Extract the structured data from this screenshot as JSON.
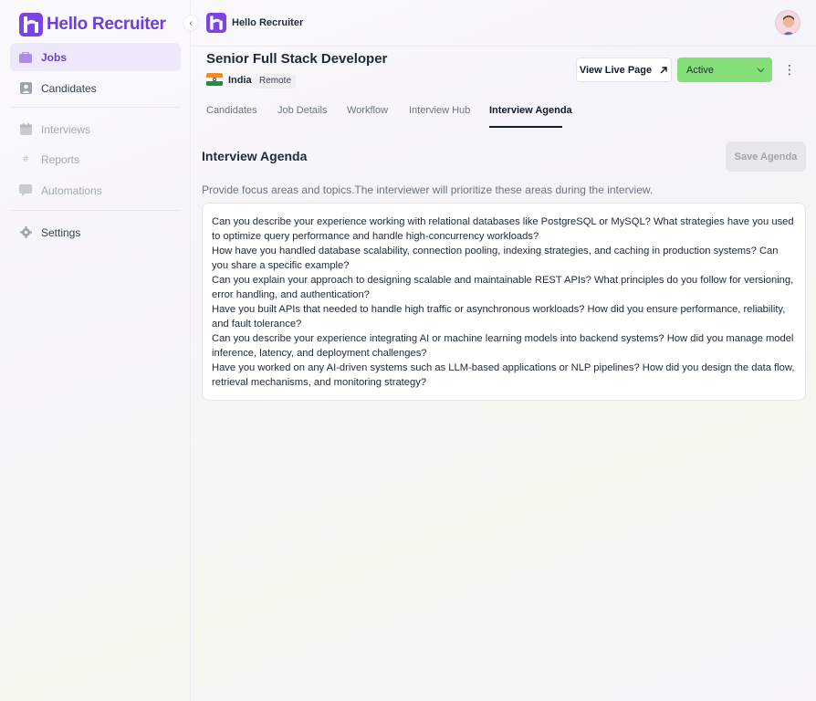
{
  "brand": {
    "name": "Hello Recruiter",
    "color": "#6d3fd8"
  },
  "sidebar": {
    "items": [
      {
        "label": "Jobs",
        "icon": "briefcase-icon",
        "state": "active"
      },
      {
        "label": "Candidates",
        "icon": "person-icon",
        "state": "normal"
      },
      {
        "label": "Interviews",
        "icon": "calendar-icon",
        "state": "disabled"
      },
      {
        "label": "Reports",
        "icon": "hash-icon",
        "state": "disabled"
      },
      {
        "label": "Automations",
        "icon": "chat-icon",
        "state": "disabled"
      },
      {
        "label": "Settings",
        "icon": "gear-icon",
        "state": "normal"
      }
    ]
  },
  "header": {
    "title": "Hello Recruiter",
    "collapse_icon": "chevron-left-icon"
  },
  "job": {
    "title": "Senior Full Stack Developer",
    "country": "India",
    "work_mode": "Remote",
    "view_live_label": "View Live Page",
    "status": "Active",
    "status_color": "#86e07a"
  },
  "tabs": [
    {
      "label": "Candidates",
      "active": false
    },
    {
      "label": "Job Details",
      "active": false
    },
    {
      "label": "Workflow",
      "active": false
    },
    {
      "label": "Interview Hub",
      "active": false
    },
    {
      "label": "Interview Agenda",
      "active": true
    }
  ],
  "agenda": {
    "title": "Interview Agenda",
    "save_label": "Save Agenda",
    "help_text": "Provide focus areas and topics.The interviewer will prioritize these areas during the interview.",
    "content": "Can you describe your experience working with relational databases like PostgreSQL or MySQL? What strategies have you used to optimize query performance and handle high-concurrency workloads?\nHow have you handled database scalability, connection pooling, indexing strategies, and caching in production systems? Can you share a specific example?\nCan you explain your approach to designing scalable and maintainable REST APIs? What principles do you follow for versioning, error handling, and authentication?\nHave you built APIs that needed to handle high traffic or asynchronous workloads? How did you ensure performance, reliability, and fault tolerance?\nCan you describe your experience integrating AI or machine learning models into backend systems? How did you manage model inference, latency, and deployment challenges?\nHave you worked on any AI-driven systems such as LLM-based applications or NLP pipelines? How did you design the data flow, retrieval mechanisms, and monitoring strategy?"
  }
}
